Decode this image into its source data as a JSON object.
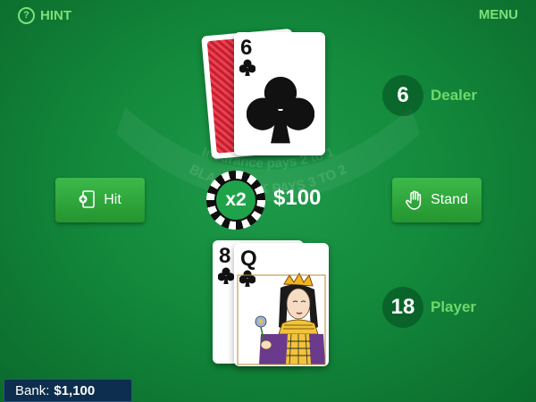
{
  "top_bar": {
    "hint_label": "HINT",
    "menu_label": "MENU"
  },
  "felt": {
    "insurance_text": "Insurance pays 2 to 1",
    "blackjack_text": "BLACKJACK PAYS 3 TO 2"
  },
  "dealer": {
    "score": "6",
    "label": "Dealer",
    "cards": [
      {
        "face": "down"
      },
      {
        "rank": "6",
        "suit": "clubs"
      }
    ]
  },
  "player": {
    "score": "18",
    "label": "Player",
    "cards": [
      {
        "rank": "8",
        "suit": "clubs"
      },
      {
        "rank": "Q",
        "suit": "clubs"
      }
    ]
  },
  "actions": {
    "hit_label": "Hit",
    "stand_label": "Stand"
  },
  "bet": {
    "multiplier": "x2",
    "amount": "$100"
  },
  "bank": {
    "label": "Bank:",
    "amount": "$1,100"
  },
  "colors": {
    "felt": "#138a3c",
    "accent_green": "#7ee07a",
    "button_green": "#2ea63b",
    "card_back_red": "#c81e2d",
    "bank_bg": "#0d2e4e"
  }
}
